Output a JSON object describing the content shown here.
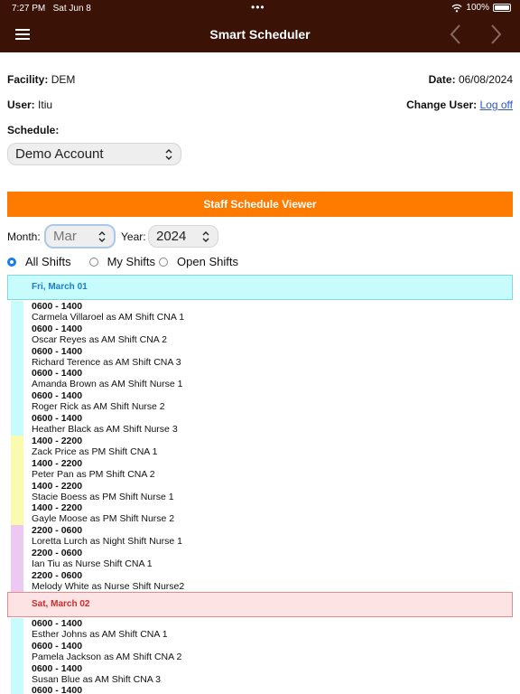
{
  "status_bar": {
    "time": "7:27 PM",
    "date": "Sat Jun 8",
    "battery": "100%"
  },
  "nav": {
    "title": "Smart Scheduler"
  },
  "facility": {
    "label": "Facility:",
    "value": "DEM"
  },
  "date": {
    "label": "Date:",
    "value": "06/08/2024"
  },
  "user": {
    "label": "User:",
    "value": "Itiu"
  },
  "change_user": {
    "label": "Change User:",
    "link": "Log off"
  },
  "schedule": {
    "label": "Schedule:",
    "selected": "Demo Account"
  },
  "viewer_title": "Staff Schedule Viewer",
  "filters": {
    "month_label": "Month:",
    "month_value": "Mar",
    "year_label": "Year:",
    "year_value": "2024"
  },
  "radios": {
    "all": "All Shifts",
    "mine": "My Shifts",
    "open": "Open Shifts"
  },
  "colors": {
    "header_bg": "#3a1206",
    "accent": "#ff7b00",
    "am_stripe": "#c8fbfb",
    "pm_stripe": "#fbfbb0",
    "night_stripe": "#ecc8f3"
  },
  "days": [
    {
      "title": "Fri, March 01",
      "groups": [
        {
          "kind": "am",
          "entries": [
            {
              "time": "0600 - 1400",
              "who": "Carmela Villaroel as AM Shift CNA 1"
            },
            {
              "time": "0600 - 1400",
              "who": "Oscar Reyes as AM Shift CNA 2"
            },
            {
              "time": "0600 - 1400",
              "who": "Richard Terence as AM Shift CNA 3"
            },
            {
              "time": "0600 - 1400",
              "who": "Amanda Brown as AM Shift Nurse 1"
            },
            {
              "time": "0600 - 1400",
              "who": "Roger Rick as AM Shift Nurse 2"
            },
            {
              "time": "0600 - 1400",
              "who": "Heather Black as AM Shift Nurse 3"
            }
          ]
        },
        {
          "kind": "pm",
          "entries": [
            {
              "time": "1400 - 2200",
              "who": "Zack Price as PM Shift CNA 1"
            },
            {
              "time": "1400 - 2200",
              "who": "Peter Pan as PM Shift CNA 2"
            },
            {
              "time": "1400 - 2200",
              "who": "Stacie Boess as PM Shift Nurse 1"
            },
            {
              "time": "1400 - 2200",
              "who": "Gayle Moose as PM Shift Nurse 2"
            }
          ]
        },
        {
          "kind": "night",
          "entries": [
            {
              "time": "2200 - 0600",
              "who": "Loretta Lurch as Night Shift Nurse 1"
            },
            {
              "time": "2200 - 0600",
              "who": "Ian Tiu as Nurse Shift CNA 1"
            },
            {
              "time": "2200 - 0600",
              "who": "Melody White as Nurse Shift Nurse2"
            }
          ]
        }
      ]
    },
    {
      "title": "Sat, March 02",
      "groups": [
        {
          "kind": "am",
          "entries": [
            {
              "time": "0600 - 1400",
              "who": "Esther Johns as AM Shift CNA 1"
            },
            {
              "time": "0600 - 1400",
              "who": "Pamela Jackson as AM Shift CNA 2"
            },
            {
              "time": "0600 - 1400",
              "who": "Susan Blue as AM Shift CNA 3"
            },
            {
              "time": "0600 - 1400",
              "who": ""
            }
          ]
        }
      ]
    }
  ]
}
